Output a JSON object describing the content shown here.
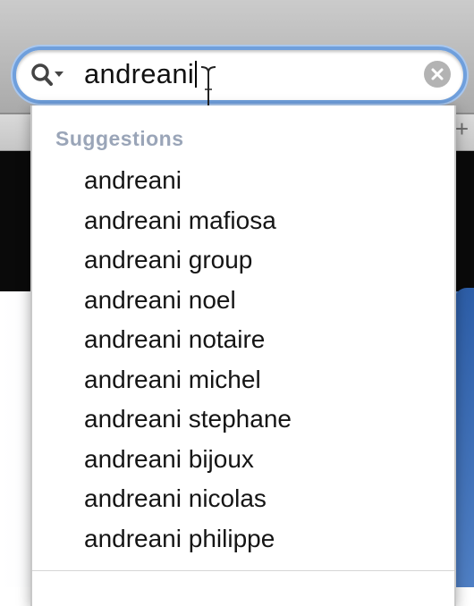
{
  "search": {
    "value": "andreani",
    "icon": "magnifier-with-dropdown-icon"
  },
  "suggestions": {
    "header": "Suggestions",
    "items": [
      "andreani",
      "andreani mafiosa",
      "andreani group",
      "andreani noel",
      "andreani notaire",
      "andreani michel",
      "andreani stephane",
      "andreani bijoux",
      "andreani nicolas",
      "andreani philippe"
    ]
  },
  "tab_strip": {
    "new_tab_symbol": "+"
  },
  "colors": {
    "focus_ring": "#6f9fdc",
    "section_header": "#9aa5b8",
    "clear_button": "#b3b3b3"
  }
}
